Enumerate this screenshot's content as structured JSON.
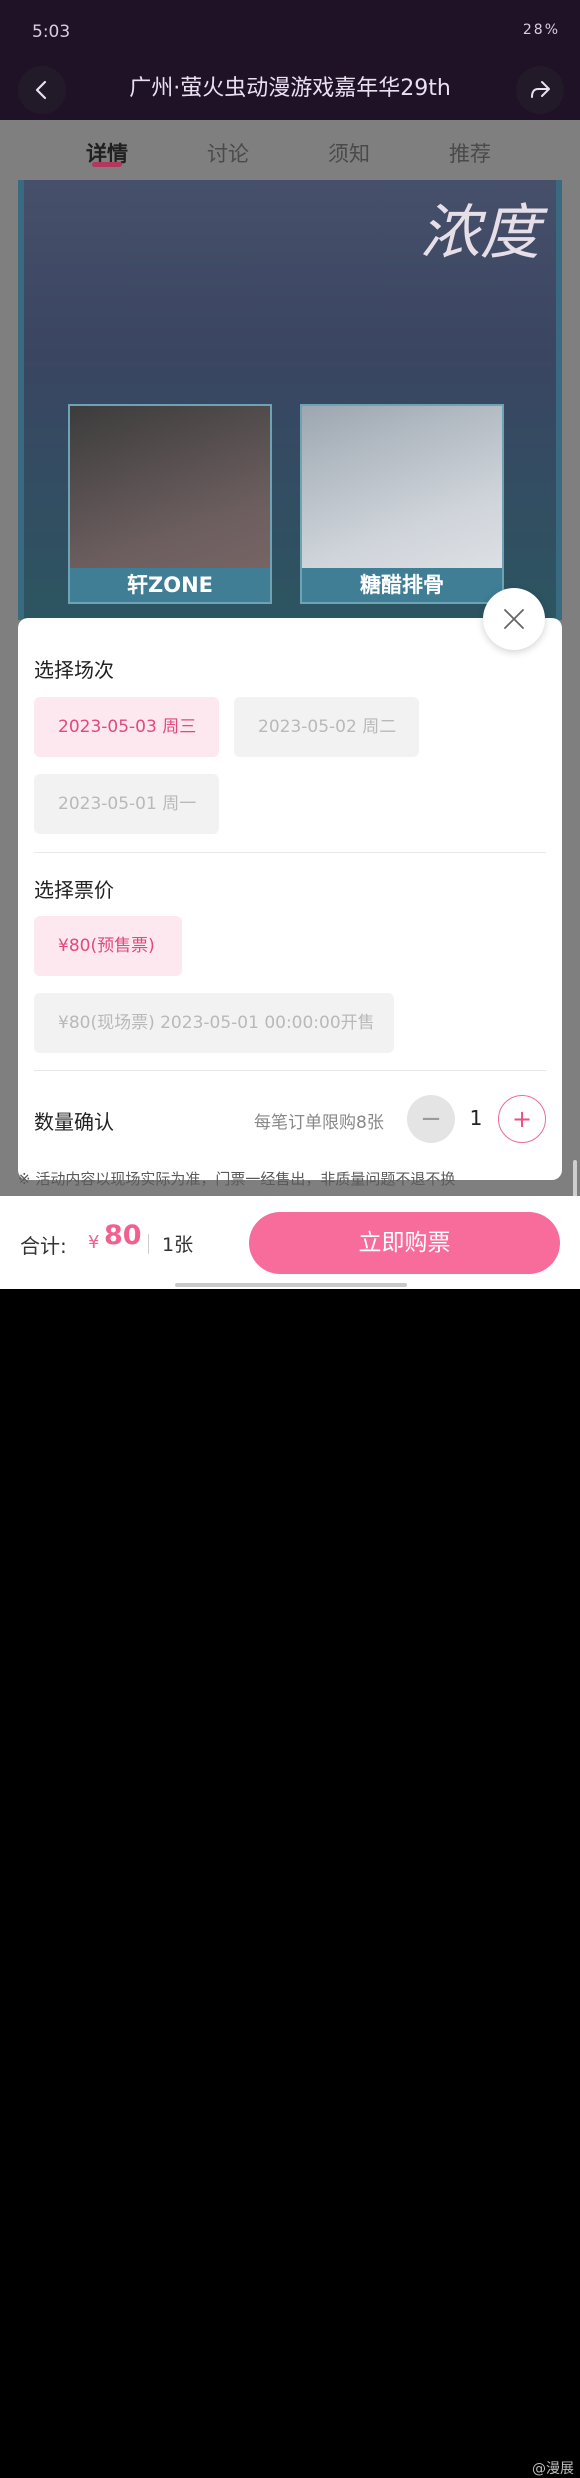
{
  "status_bar": {
    "time": "5:03",
    "right_text": "28%"
  },
  "header": {
    "title": "广州·萤火虫动漫游戏嘉年华29th"
  },
  "tabs": [
    {
      "label": "详情",
      "active": true
    },
    {
      "label": "讨论",
      "active": false
    },
    {
      "label": "须知",
      "active": false
    },
    {
      "label": "推荐",
      "active": false
    }
  ],
  "poster": {
    "script_text": "浓度",
    "guest1": "轩ZONE",
    "guest2": "糖醋排骨"
  },
  "sheet": {
    "session_title": "选择场次",
    "sessions": [
      {
        "label": "2023-05-03 周三",
        "state": "selected"
      },
      {
        "label": "2023-05-02 周二",
        "state": "disabled"
      },
      {
        "label": "2023-05-01 周一",
        "state": "disabled"
      }
    ],
    "price_title": "选择票价",
    "prices": [
      {
        "label": "¥80(预售票)",
        "state": "selected"
      },
      {
        "label": "¥80(现场票) 2023-05-01 00:00:00开售",
        "state": "disabled"
      }
    ],
    "quantity_label": "数量确认",
    "limit_text": "每笔订单限购8张",
    "quantity": "1",
    "minus": "−",
    "plus": "+"
  },
  "peek_text": "※ 活动内容以现场实际为准，门票一经售出，非质量问题不退不换",
  "bottom": {
    "total_label": "合计:",
    "currency": "¥",
    "price": "80",
    "count": "1张",
    "buy_label": "立即购票"
  },
  "watermark": "@漫展",
  "colors": {
    "accent": "#f76c9b",
    "selected_bg": "#fde8f0",
    "disabled_bg": "#f2f2f2"
  }
}
